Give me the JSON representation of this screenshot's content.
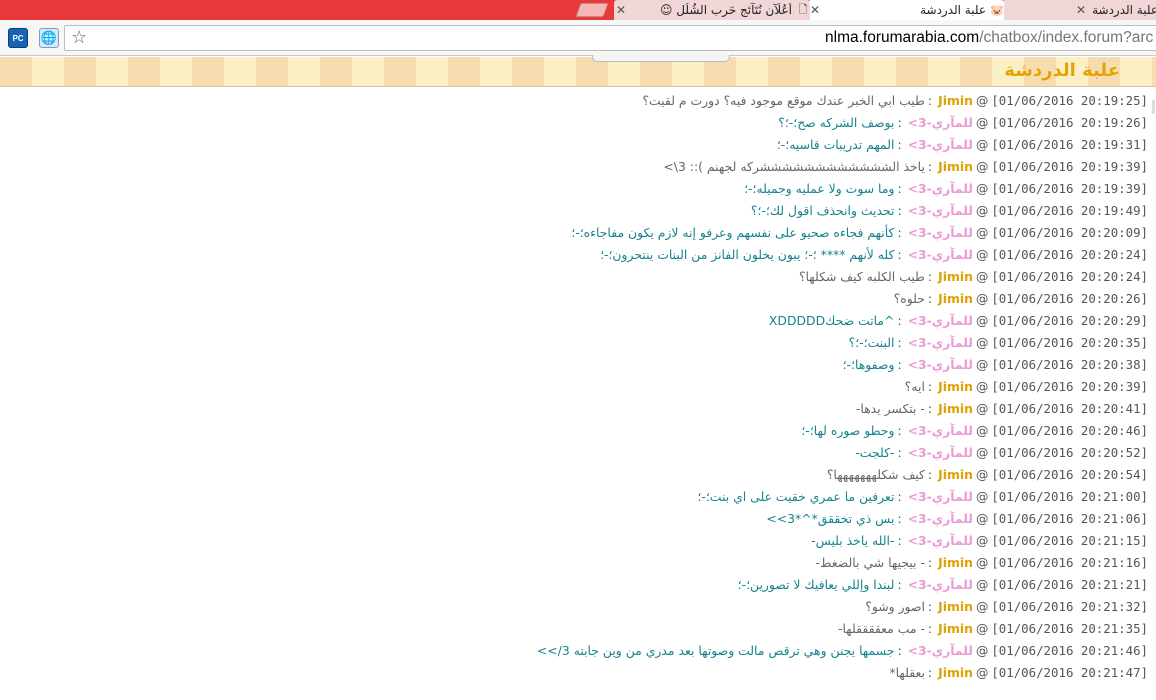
{
  "tabs": [
    {
      "title": "علبة الدردشة",
      "state": "inactive"
    },
    {
      "title": "علبة الدردشة",
      "state": "active",
      "favicon": "🐷"
    },
    {
      "title": "أعُلُآن نُتَآئج حَرب الشُلُل ☺",
      "state": "inactive"
    }
  ],
  "toolbar": {
    "pc_label": "PC",
    "url_host": "nlma.forumarabia.com",
    "url_path": "/chatbox/index.forum?arc"
  },
  "page": {
    "title": "علبة الدردشة"
  },
  "colors": {
    "jimin": "#e0a000",
    "lmary": "#ec9ad6",
    "teal": "#17828f",
    "gray": "#666666",
    "tab_strip": "#e8383a"
  },
  "messages": [
    {
      "time": "[01/06/2016 20:19:25]",
      "user": "Jimin",
      "text": "طيب ابي الخبر عندك موقع موجود فيه؟ دورت م لقيت؟"
    },
    {
      "time": "[01/06/2016 20:19:26]",
      "user": "للمآري-3>",
      "text": "بوصف الشركه صح؛-؛؟"
    },
    {
      "time": "[01/06/2016 20:19:31]",
      "user": "للمآري-3>",
      "text": "المهم تدريبات قاسيه؛-؛"
    },
    {
      "time": "[01/06/2016 20:19:39]",
      "user": "Jimin",
      "text": "ياخذ الششششششششششششركه لجهنم ):: 3\\>"
    },
    {
      "time": "[01/06/2016 20:19:39]",
      "user": "للمآري-3>",
      "text": "وما سوت ولا عمليه وجميله؛-؛"
    },
    {
      "time": "[01/06/2016 20:19:49]",
      "user": "للمآري-3>",
      "text": "تحديث وانحذف اقول لك؛-؛؟"
    },
    {
      "time": "[01/06/2016 20:20:09]",
      "user": "للمآري-3>",
      "text": "كأنهم فجاءه صحيو على نفسهم وعرفو إنه لازم يكون مفاجاءه؛-؛"
    },
    {
      "time": "[01/06/2016 20:20:24]",
      "user": "للمآري-3>",
      "text": "كله لأنهم **** ؛-؛ يبون يخلون الفانز من البنات ينتحرون؛-؛"
    },
    {
      "time": "[01/06/2016 20:20:24]",
      "user": "Jimin",
      "text": "طيب الكلبه كيف شكلها؟"
    },
    {
      "time": "[01/06/2016 20:20:26]",
      "user": "Jimin",
      "text": "حلوه؟"
    },
    {
      "time": "[01/06/2016 20:20:29]",
      "user": "للمآري-3>",
      "text": "^ماتت ضحكXDDDDD"
    },
    {
      "time": "[01/06/2016 20:20:35]",
      "user": "للمآري-3>",
      "text": "البنت؛-؛؟"
    },
    {
      "time": "[01/06/2016 20:20:38]",
      "user": "للمآري-3>",
      "text": "وصفوها؛-؛"
    },
    {
      "time": "[01/06/2016 20:20:39]",
      "user": "Jimin",
      "text": "ايه؟"
    },
    {
      "time": "[01/06/2016 20:20:41]",
      "user": "Jimin",
      "text": "- بتكسر يدها-"
    },
    {
      "time": "[01/06/2016 20:20:46]",
      "user": "للمآري-3>",
      "text": "وحطو صوره لها؛-؛"
    },
    {
      "time": "[01/06/2016 20:20:52]",
      "user": "للمآري-3>",
      "text": "-كلجت-"
    },
    {
      "time": "[01/06/2016 20:20:54]",
      "user": "Jimin",
      "text": "كيف شكلههههههها؟"
    },
    {
      "time": "[01/06/2016 20:21:00]",
      "user": "للمآري-3>",
      "text": "تعرفين ما عمري خقيت على اي بنت؛-؛"
    },
    {
      "time": "[01/06/2016 20:21:06]",
      "user": "للمآري-3>",
      "text": "بس ذي تخققق*^*3>>"
    },
    {
      "time": "[01/06/2016 20:21:15]",
      "user": "للمآري-3>",
      "text": "-الله ياخذ بليس-"
    },
    {
      "time": "[01/06/2016 20:21:16]",
      "user": "Jimin",
      "text": "- بيجيها شي بالضغط-"
    },
    {
      "time": "[01/06/2016 20:21:21]",
      "user": "للمآري-3>",
      "text": "لبندا وإللي يعافيك لا تصورين؛-؛"
    },
    {
      "time": "[01/06/2016 20:21:32]",
      "user": "Jimin",
      "text": "اصور وشو؟"
    },
    {
      "time": "[01/06/2016 20:21:35]",
      "user": "Jimin",
      "text": "- مب معققققلها-"
    },
    {
      "time": "[01/06/2016 20:21:46]",
      "user": "للمآري-3>",
      "text": "جسمها يجنن وهي ترقص مالت وصوتها بعد مدري من وين جابته 3/>>"
    },
    {
      "time": "[01/06/2016 20:21:47]",
      "user": "Jimin",
      "text": "بعقلها*"
    }
  ]
}
